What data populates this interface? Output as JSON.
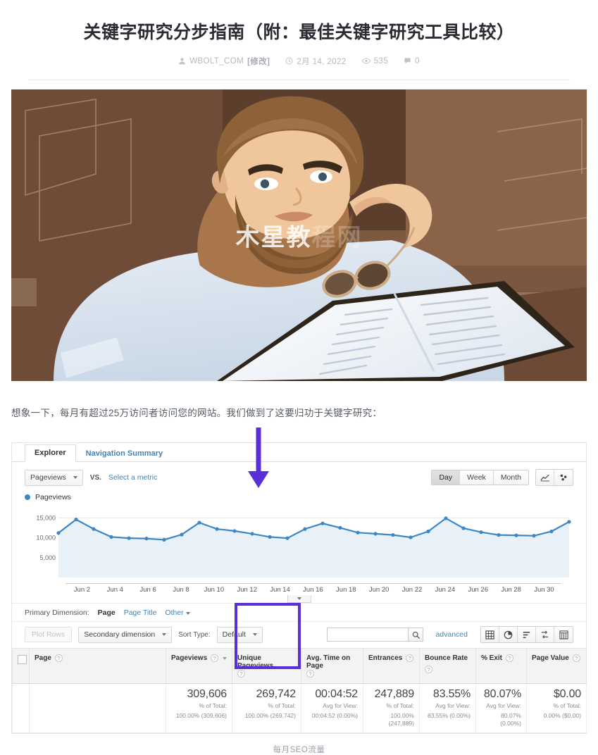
{
  "article": {
    "title": "关键字研究分步指南（附：最佳关键字研究工具比较）",
    "meta": {
      "author": "WBOLT_COM",
      "edit_label": "[修改]",
      "date": "2月 14, 2022",
      "views": "535",
      "comments": "0"
    },
    "hero_watermark_solid": "木星教",
    "hero_watermark_fade": "程网",
    "paragraph": "想象一下，每月有超过25万访问者访问您的网站。我们做到了这要归功于关键字研究：",
    "figure_caption": "每月SEO流量"
  },
  "analytics": {
    "tabs": [
      {
        "label": "Explorer",
        "active": true
      },
      {
        "label": "Navigation Summary",
        "active": false
      }
    ],
    "metric_bar": {
      "metric_select": "Pageviews",
      "vs_label": "VS.",
      "select_metric_link": "Select a metric",
      "granularity": [
        {
          "label": "Day",
          "active": true
        },
        {
          "label": "Week",
          "active": false
        },
        {
          "label": "Month",
          "active": false
        }
      ],
      "chart_type_icons": [
        "line-chart-icon",
        "scatter-chart-icon"
      ]
    },
    "legend": "Pageviews",
    "primary_dimension": {
      "label": "Primary Dimension:",
      "current": "Page",
      "options": [
        "Page Title",
        "Other"
      ]
    },
    "controls": {
      "plot_rows": "Plot Rows",
      "secondary_dimension": "Secondary dimension",
      "sort_type_label": "Sort Type:",
      "sort_type_value": "Default",
      "search_value": "",
      "search_placeholder": "",
      "advanced_link": "advanced",
      "view_icons": [
        "table-view-icon",
        "pie-view-icon",
        "bar-view-icon",
        "comparison-view-icon",
        "pivot-view-icon"
      ]
    },
    "table": {
      "columns": [
        {
          "label": "Page",
          "help": true,
          "align": "left",
          "highlight": false
        },
        {
          "label": "Pageviews",
          "help": true,
          "align": "left",
          "highlight": false,
          "sorted": true
        },
        {
          "label": "Unique Pageviews",
          "help": true,
          "align": "left",
          "highlight": true
        },
        {
          "label": "Avg. Time on Page",
          "help": true,
          "align": "left",
          "highlight": false
        },
        {
          "label": "Entrances",
          "help": true,
          "align": "left",
          "highlight": false
        },
        {
          "label": "Bounce Rate",
          "help": true,
          "align": "left",
          "highlight": false
        },
        {
          "label": "% Exit",
          "help": true,
          "align": "left",
          "highlight": false
        },
        {
          "label": "Page Value",
          "help": true,
          "align": "left",
          "highlight": false
        }
      ],
      "summary_row": [
        {
          "value": "309,606",
          "sub1": "% of Total:",
          "sub2": "100.00% (309,606)"
        },
        {
          "value": "269,742",
          "sub1": "% of Total:",
          "sub2": "100.00% (269,742)"
        },
        {
          "value": "00:04:52",
          "sub1": "Avg for View:",
          "sub2": "00:04:52 (0.00%)"
        },
        {
          "value": "247,889",
          "sub1": "% of Total:",
          "sub2": "100.00% (247,889)"
        },
        {
          "value": "83.55%",
          "sub1": "Avg for View:",
          "sub2": "83.55% (0.00%)"
        },
        {
          "value": "80.07%",
          "sub1": "Avg for View:",
          "sub2": "80.07% (0.00%)"
        },
        {
          "value": "$0.00",
          "sub1": "% of Total:",
          "sub2": "0.00% ($0.00)"
        }
      ]
    },
    "annotation_color": "#5b2fd6"
  },
  "chart_data": {
    "type": "line",
    "title": "Pageviews",
    "xlabel": "",
    "ylabel": "",
    "ylim": [
      0,
      17000
    ],
    "yticks": [
      5000,
      10000,
      15000
    ],
    "ytick_labels": [
      "5,000",
      "10,000",
      "15,000"
    ],
    "grid": true,
    "legend": [
      "Pageviews"
    ],
    "legend_position": "top-left",
    "series_color": "#3c87c4",
    "x_tick_labels": [
      "Jun 2",
      "Jun 4",
      "Jun 6",
      "Jun 8",
      "Jun 10",
      "Jun 12",
      "Jun 14",
      "Jun 16",
      "Jun 18",
      "Jun 20",
      "Jun 22",
      "Jun 24",
      "Jun 26",
      "Jun 28",
      "Jun 30"
    ],
    "x": [
      "Jun 1",
      "Jun 2",
      "Jun 3",
      "Jun 4",
      "Jun 5",
      "Jun 6",
      "Jun 7",
      "Jun 8",
      "Jun 9",
      "Jun 10",
      "Jun 11",
      "Jun 12",
      "Jun 13",
      "Jun 14",
      "Jun 15",
      "Jun 16",
      "Jun 17",
      "Jun 18",
      "Jun 19",
      "Jun 20",
      "Jun 21",
      "Jun 22",
      "Jun 23",
      "Jun 24",
      "Jun 25",
      "Jun 26",
      "Jun 27",
      "Jun 28",
      "Jun 29",
      "Jun 30"
    ],
    "series": [
      {
        "name": "Pageviews",
        "values": [
          11200,
          14600,
          12200,
          10200,
          9900,
          9800,
          9500,
          10800,
          13800,
          12200,
          11700,
          11000,
          10200,
          9900,
          12200,
          13600,
          12500,
          11300,
          11000,
          10700,
          10100,
          11600,
          14900,
          12400,
          11400,
          10700,
          10600,
          10500,
          11600,
          14000
        ]
      }
    ]
  }
}
